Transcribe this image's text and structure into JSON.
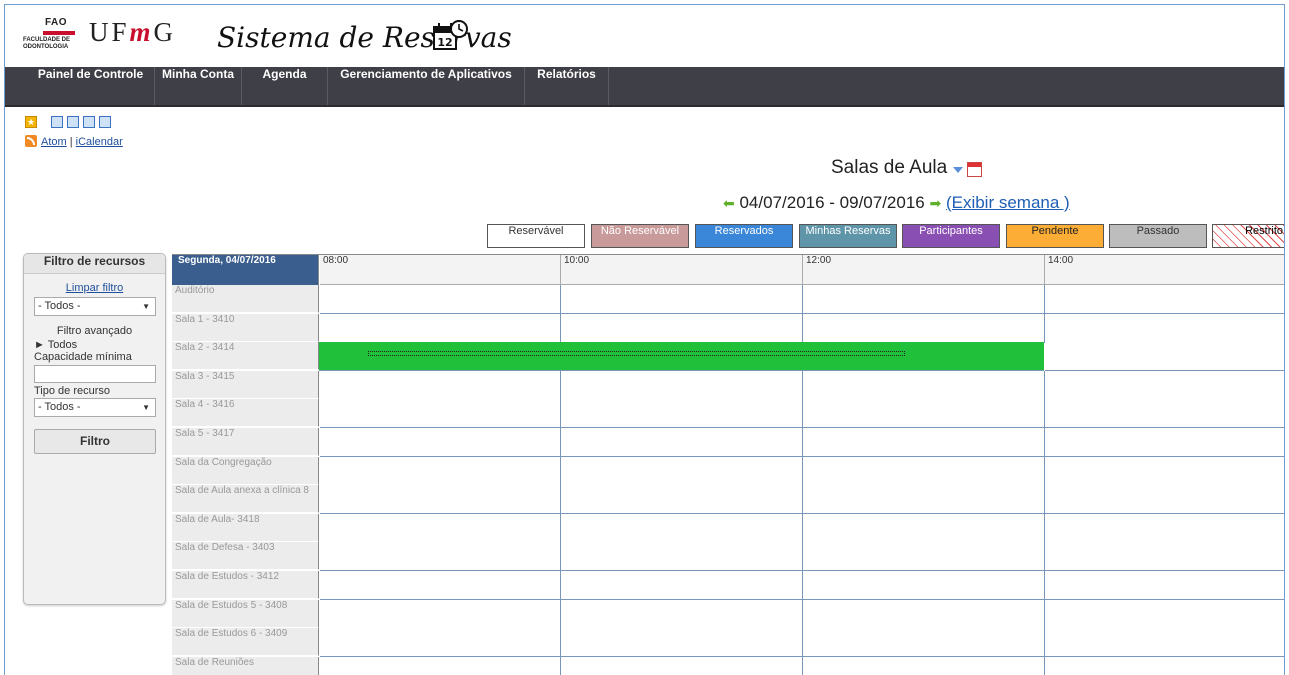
{
  "header": {
    "fao_text": "FAO",
    "fao_subtitle_1": "FACULDADE DE",
    "fao_subtitle_2": "ODONTOLOGIA",
    "ufmg_u": "UF",
    "ufmg_m": "m",
    "ufmg_g": "G",
    "app_title": "Sistema de Reservas",
    "calendar_icon_day": "12"
  },
  "nav": {
    "items": [
      {
        "label": "Painel de Controle"
      },
      {
        "label": "Minha Conta"
      },
      {
        "label": "Agenda"
      },
      {
        "label": "Gerenciamento de Aplicativos"
      },
      {
        "label": "Relatórios"
      }
    ]
  },
  "toolbar": {
    "icons": [
      "star-icon",
      "view-day-icon",
      "view-week-icon",
      "view-list-icon",
      "view-month-icon",
      "rss-icon"
    ],
    "link_atom": "Atom",
    "separator": "|",
    "link_ical": "iCalendar"
  },
  "schedule": {
    "title": "Salas de Aula",
    "date_range": "04/07/2016 - 09/07/2016",
    "week_link": "(Exibir semana )"
  },
  "legend": [
    {
      "label": "Reservável",
      "bg": "#ffffff",
      "fg": "#333333"
    },
    {
      "label": "Não Reservável",
      "bg": "#c99a9a",
      "fg": "#ffffff"
    },
    {
      "label": "Reservados",
      "bg": "#3a86d8",
      "fg": "#ffffff"
    },
    {
      "label": "Minhas Reservas",
      "bg": "#5f95a8",
      "fg": "#ffffff"
    },
    {
      "label": "Participantes",
      "bg": "#8a4fb3",
      "fg": "#ffffff"
    },
    {
      "label": "Pendente",
      "bg": "#fbad35",
      "fg": "#222222"
    },
    {
      "label": "Passado",
      "bg": "#bdbdbd",
      "fg": "#333333"
    },
    {
      "label": "Restrito",
      "bg": "#ffffff",
      "fg": "#333333"
    }
  ],
  "filter": {
    "title": "Filtro de recursos",
    "clear": "Limpar filtro",
    "select_all": "- Todos -",
    "advanced": "Filtro avançado",
    "tree_all": "► Todos",
    "min_capacity": "Capacidade mínima",
    "resource_type": "Tipo de recurso",
    "type_value": "- Todos -",
    "button": "Filtro"
  },
  "grid": {
    "day_label": "Segunda, 04/07/2016",
    "times": [
      "08:00",
      "10:00",
      "12:00",
      "14:00"
    ],
    "rooms": [
      "Auditório",
      "Sala 1 - 3410",
      "Sala 2 - 3414",
      "Sala 3 - 3415",
      "Sala 4 - 3416",
      "Sala 5 - 3417",
      "Sala da Congregação",
      "Sala de Aula anexa a clínica 8",
      "Sala de Aula- 3418",
      "Sala de Defesa - 3403",
      "Sala de Estudos - 3412",
      "Sala de Estudos 5 - 3408",
      "Sala de Estudos 6 - 3409",
      "Sala de Reuniões"
    ],
    "reserved_color": "#21c03a"
  }
}
